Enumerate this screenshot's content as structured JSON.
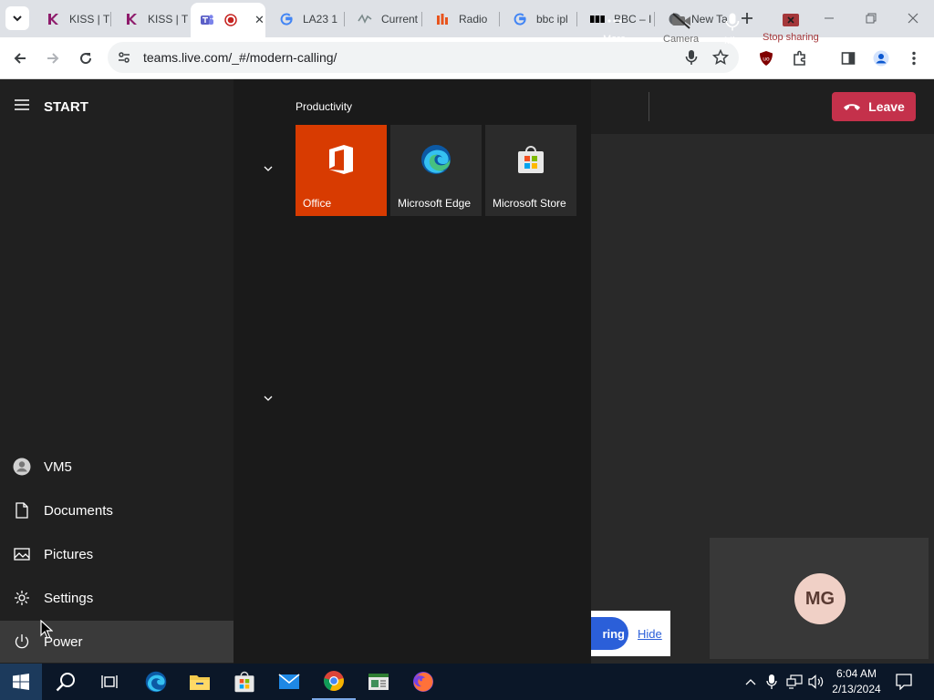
{
  "browser": {
    "tabs": [
      {
        "title": "KISS | T",
        "icon": "kiss-icon"
      },
      {
        "title": "KISS | T",
        "icon": "kiss-icon"
      },
      {
        "title": "",
        "icon": "teams-icon",
        "recording": true,
        "active": true
      },
      {
        "title": "LA23 1",
        "icon": "google-icon"
      },
      {
        "title": "Current",
        "icon": "chart-icon"
      },
      {
        "title": "Radio",
        "icon": "radio-icon"
      },
      {
        "title": "bbc ipl",
        "icon": "google-icon"
      },
      {
        "title": "BBC – I",
        "icon": "bbc-icon"
      },
      {
        "title": "New Ta",
        "icon": "chrome-icon"
      }
    ],
    "address": "teams.live.com/_#/modern-calling/"
  },
  "teams": {
    "toolbar": {
      "more": "More",
      "camera": "Camera",
      "mic": "Mic",
      "stop_sharing": "Stop sharing",
      "leave": "Leave"
    },
    "participant_initials": "MG",
    "sharing_text": "ring",
    "hide_label": "Hide"
  },
  "start_menu": {
    "header": "START",
    "user": "VM5",
    "items": [
      "Documents",
      "Pictures",
      "Settings",
      "Power"
    ],
    "group_label": "Productivity",
    "tiles": [
      {
        "label": "Office",
        "color": "#d83b01"
      },
      {
        "label": "Microsoft Edge",
        "color": "#2b2b2b"
      },
      {
        "label": "Microsoft Store",
        "color": "#2b2b2b"
      }
    ]
  },
  "taskbar": {
    "time": "6:04 AM",
    "date": "2/13/2024"
  },
  "colors": {
    "leave_red": "#c4314b",
    "office_orange": "#d83b01",
    "teams_purple": "#5b5fc7",
    "taskbar": "#0b1728"
  }
}
